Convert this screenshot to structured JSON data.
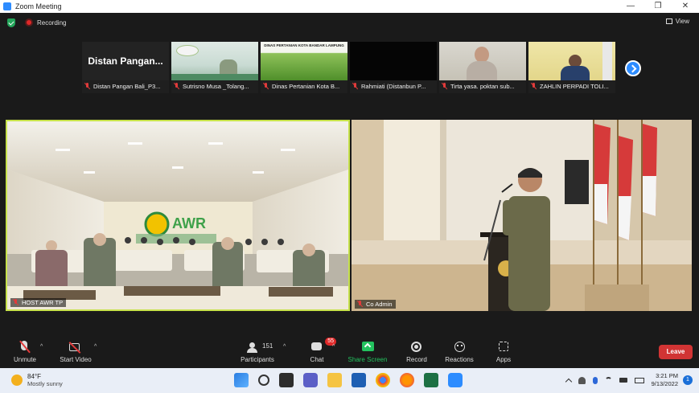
{
  "window": {
    "title": "Zoom Meeting",
    "controls": [
      "—",
      "❐",
      "✕"
    ]
  },
  "status": {
    "recording_label": "Recording",
    "view_label": "View"
  },
  "thumbnails": [
    {
      "name": "Distan Pangan Bali_P3...",
      "tile_text": "Distan Pangan..."
    },
    {
      "name": "Sutrisno Musa _Tolang...",
      "tile_text": ""
    },
    {
      "name": "Dinas Pertanian Kota B...",
      "tile_text": "DINAS PERTANIAN KOTA BANDAR LAMPUNG"
    },
    {
      "name": "Rahmiati (Distanbun P...",
      "tile_text": ""
    },
    {
      "name": "Tirta yasa. poktan sub...",
      "tile_text": ""
    },
    {
      "name": "ZAHLIN PERPADI TOLI...",
      "tile_text": ""
    }
  ],
  "videos": {
    "left": {
      "label": "HOST AWR TP",
      "sign_text": "AWR"
    },
    "right": {
      "label": "Co Admin"
    }
  },
  "toolbar": {
    "unmute": "Unmute",
    "start_video": "Start Video",
    "participants": "Participants",
    "participants_count": "151",
    "chat": "Chat",
    "chat_badge": "55",
    "share": "Share Screen",
    "record": "Record",
    "reactions": "Reactions",
    "apps": "Apps",
    "leave": "Leave",
    "share_color": "#23c25e"
  },
  "taskbar": {
    "temp": "84°F",
    "condition": "Mostly sunny",
    "time": "3:21 PM",
    "date": "9/13/2022",
    "notification_count": "1"
  }
}
